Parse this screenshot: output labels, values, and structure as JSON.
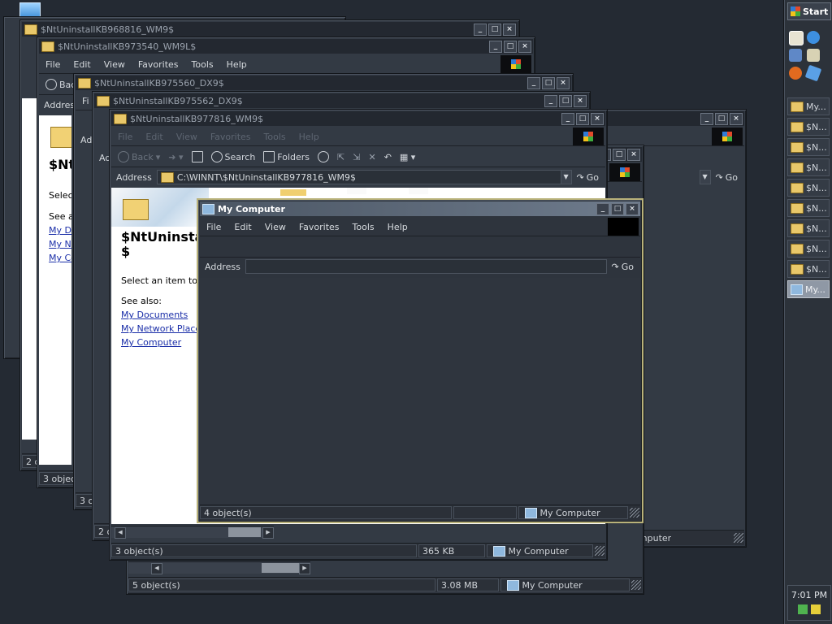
{
  "desktop": {
    "icon": "monitor-icon"
  },
  "menu_labels": [
    "File",
    "Edit",
    "View",
    "Favorites",
    "Tools",
    "Help"
  ],
  "windows": {
    "w1": {
      "title": "$NtUninstallKB968816_WM9$",
      "status1": "2 ol"
    },
    "w2": {
      "title": "$NtUninstallKB973540_WM9L$",
      "toolbar_back": "Back",
      "address_label": "Addres",
      "status1": "3 object",
      "partial_title": "$Nt",
      "select_text": "Select",
      "see_also": "See a",
      "links": [
        "My Do",
        "My Ne",
        "My Co"
      ]
    },
    "w3": {
      "title": "$NtUninstallKB975560_DX9$",
      "menu_file": "Fi",
      "address_label": "Ad",
      "status1": "3 ol"
    },
    "w4": {
      "title": "$NtUninstallKB975562_DX9$",
      "status1": "2 ol",
      "address_label": "Ad"
    },
    "w5": {
      "title": "$NtUninstallKB977816_WM9$",
      "toolbar": {
        "back": "Back",
        "search": "Search",
        "folders": "Folders"
      },
      "address_label": "Address",
      "address_value": "C:\\WINNT\\$NtUninstallKB977816_WM9$",
      "go": "Go",
      "panel_title_line1": "$NtUninstal",
      "panel_title_line2": "$",
      "select_text": "Select an item to vie",
      "see_also": "See also:",
      "links": [
        "My Documents",
        "My Network Places",
        "My Computer"
      ],
      "status_objects": "3 object(s)",
      "status_size": "365 KB",
      "status_location": "My Computer"
    },
    "w6": {
      "go": "Go",
      "status_location": "My Computer"
    },
    "w7": {
      "status_objects": "5 object(s)",
      "status_size": "3.08 MB",
      "status_location": "My Computer",
      "status_partial": "3 o"
    },
    "mycomputer": {
      "title": "My Computer",
      "address_label": "Address",
      "address_value": "",
      "go": "Go",
      "status_objects": "4 object(s)",
      "status_location": "My Computer"
    }
  },
  "taskbar": {
    "start": "Start",
    "quicklaunch": [
      "ie-icon",
      "outlook-icon",
      "desktop-icon",
      "search-icon",
      "firefox-icon",
      "messenger-icon"
    ],
    "tasks": [
      {
        "label": "My...",
        "icon": "folder-icon",
        "active": false
      },
      {
        "label": "$N...",
        "icon": "folder-icon",
        "active": false
      },
      {
        "label": "$N...",
        "icon": "folder-icon",
        "active": false
      },
      {
        "label": "$N...",
        "icon": "folder-icon",
        "active": false
      },
      {
        "label": "$N...",
        "icon": "folder-icon",
        "active": false
      },
      {
        "label": "$N...",
        "icon": "folder-icon",
        "active": false
      },
      {
        "label": "$N...",
        "icon": "folder-icon",
        "active": false
      },
      {
        "label": "$N...",
        "icon": "folder-icon",
        "active": false
      },
      {
        "label": "$N...",
        "icon": "folder-icon",
        "active": false
      },
      {
        "label": "My...",
        "icon": "computer-icon",
        "active": true
      }
    ],
    "clock": "7:01 PM"
  }
}
